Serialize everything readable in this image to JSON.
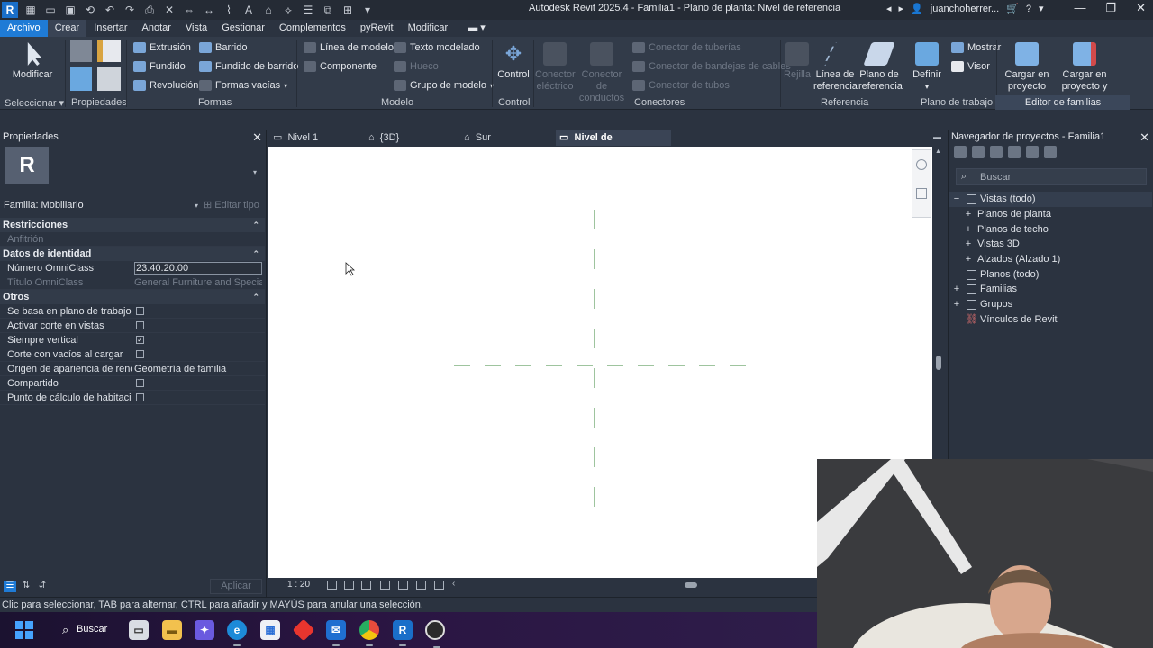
{
  "titlebar": {
    "app_icon": "R",
    "window_title": "Autodesk Revit 2025.4 - Familia1 - Plano de planta: Nivel de referencia",
    "username": "juanchoherrer...",
    "icons": [
      "open-icon",
      "save-icon",
      "undo-icon",
      "redo-icon",
      "print-icon",
      "measure-icon",
      "text-icon",
      "home-icon",
      "sync-icon",
      "switch-windows-icon"
    ]
  },
  "menu": {
    "tabs": [
      "Archivo",
      "Crear",
      "Insertar",
      "Anotar",
      "Vista",
      "Gestionar",
      "Complementos",
      "pyRevit",
      "Modificar"
    ],
    "active": "Archivo",
    "selected": "Crear"
  },
  "ribbon": {
    "seleccionar": {
      "modify_label": "Modificar",
      "panel": "Seleccionar"
    },
    "propiedades": {
      "panel": "Propiedades"
    },
    "formas": {
      "panel": "Formas",
      "items": [
        "Extrusión",
        "Fundido",
        "Revolución",
        "Barrido",
        "Fundido de barrido",
        "Formas vacías"
      ]
    },
    "modelo": {
      "panel": "Modelo",
      "items": [
        "Línea de modelo",
        "Componente",
        "Texto modelado",
        "Hueco",
        "Grupo de modelo"
      ]
    },
    "control": {
      "panel": "Control",
      "label": "Control"
    },
    "conectores": {
      "panel": "Conectores",
      "big": [
        "Conector eléctrico",
        "Conector de conductos"
      ],
      "items": [
        "Conector de tuberías",
        "Conector de bandejas de cables",
        "Conector de tubos"
      ]
    },
    "referencia": {
      "panel": "Referencia",
      "items": [
        "Rejilla",
        "Línea de referencia",
        "Plano de referencia"
      ]
    },
    "plano_trabajo": {
      "panel": "Plano de trabajo",
      "define": "Definir",
      "items": [
        "Mostrar",
        "Visor"
      ]
    },
    "editor_familias": {
      "panel": "Editor de familias",
      "items": [
        "Cargar en proyecto",
        "Cargar en proyecto y cerrar"
      ]
    }
  },
  "properties": {
    "title": "Propiedades",
    "thumbnail_letter": "R",
    "family": "Familia: Mobiliario",
    "edit_type": "Editar tipo",
    "apply": "Aplicar",
    "sections": [
      {
        "name": "Restricciones",
        "rows": [
          {
            "name": "Anfitrión",
            "value": "",
            "dim": true
          }
        ]
      },
      {
        "name": "Datos de identidad",
        "rows": [
          {
            "name": "Número OmniClass",
            "value": "23.40.20.00",
            "input": true
          },
          {
            "name": "Título OmniClass",
            "value": "General Furniture and Specialti...",
            "dim": true
          }
        ]
      },
      {
        "name": "Otros",
        "rows": [
          {
            "name": "Se basa en plano de trabajo",
            "check": false
          },
          {
            "name": "Activar corte en vistas",
            "check": false
          },
          {
            "name": "Siempre vertical",
            "check": true
          },
          {
            "name": "Corte con vacíos al cargar",
            "check": false
          },
          {
            "name": "Origen de apariencia de rend...",
            "value": "Geometría de familia"
          },
          {
            "name": "Compartido",
            "check": false
          },
          {
            "name": "Punto de cálculo de habitación",
            "check": false
          }
        ]
      }
    ]
  },
  "view_tabs": {
    "tabs": [
      "Nivel 1",
      "{3D}",
      "Sur",
      "Nivel de referencia"
    ],
    "active": "Nivel de referencia"
  },
  "view_control": {
    "scale": "1 : 20"
  },
  "browser": {
    "title": "Navegador de proyectos - Familia1",
    "search_placeholder": "Buscar",
    "tree": [
      {
        "label": "Vistas (todo)",
        "toggle": "−",
        "level": 0,
        "selected": true
      },
      {
        "label": "Planos de planta",
        "toggle": "+",
        "level": 1
      },
      {
        "label": "Planos de techo",
        "toggle": "+",
        "level": 1
      },
      {
        "label": "Vistas 3D",
        "toggle": "+",
        "level": 1
      },
      {
        "label": "Alzados (Alzado 1)",
        "toggle": "+",
        "level": 1
      },
      {
        "label": "Planos (todo)",
        "toggle": "",
        "level": 0
      },
      {
        "label": "Familias",
        "toggle": "+",
        "level": 0
      },
      {
        "label": "Grupos",
        "toggle": "+",
        "level": 0
      },
      {
        "label": "Vínculos de Revit",
        "toggle": "",
        "level": 0
      }
    ]
  },
  "status": {
    "text": "Clic para seleccionar, TAB para alternar, CTRL para añadir y MAYÚS para anular una selección."
  },
  "taskbar": {
    "search_label": "Buscar",
    "apps": [
      "task-view",
      "file-explorer",
      "copilot",
      "edge",
      "store",
      "anydesk",
      "outlook",
      "chrome",
      "revit",
      "obs"
    ]
  },
  "colors": {
    "accent": "#1f7bd6",
    "ref_plane": "#3d8a3d"
  }
}
